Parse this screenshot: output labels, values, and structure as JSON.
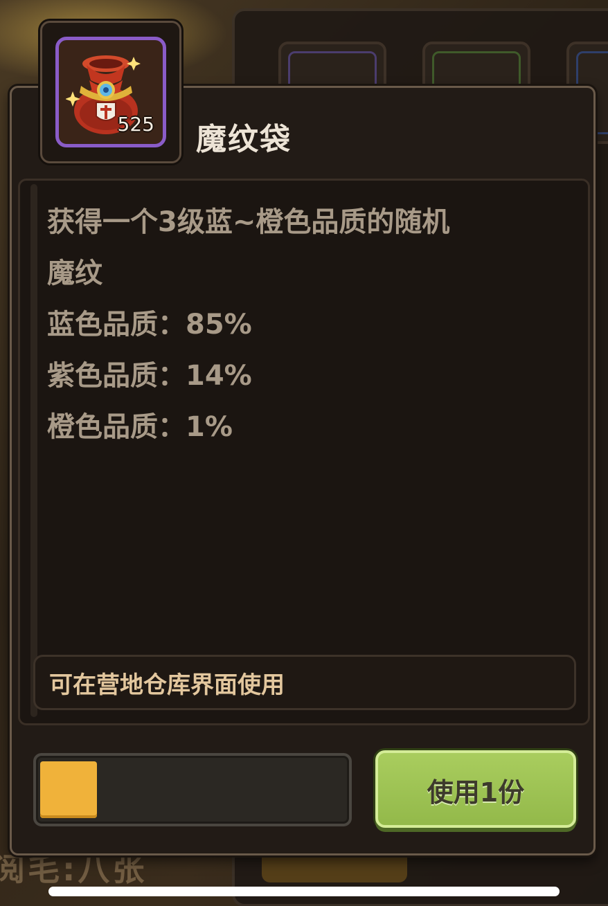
{
  "item": {
    "name": "魔纹袋",
    "count": "525",
    "icon": "magic-pattern-bag-icon",
    "slot_color": "#8a5cc8"
  },
  "description": {
    "lines": [
      "获得一个3级蓝~橙色品质的随机",
      "魔纹",
      "蓝色品质：85%",
      "紫色品质：14%",
      "橙色品质：1%"
    ]
  },
  "usage_note": "可在营地仓库界面使用",
  "quantity_slider": {
    "fill_color": "#f0b23a"
  },
  "use_button": {
    "label": "使用1份",
    "color": "#a9cd5e"
  },
  "background": {
    "partial_text": "阅毛:八张"
  }
}
